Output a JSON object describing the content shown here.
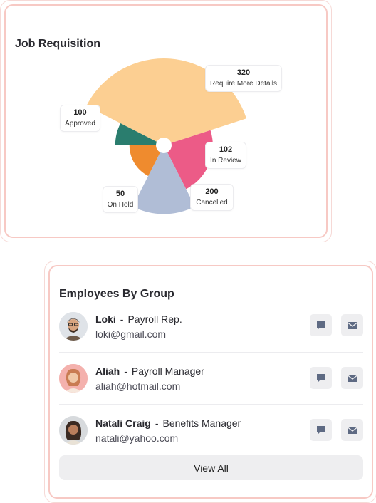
{
  "job_requisition": {
    "title": "Job Requisition"
  },
  "chart_data": {
    "type": "pie",
    "variant": "polar-area",
    "title": "Job Requisition",
    "slices": [
      {
        "label": "Require More Details",
        "value": 320,
        "color": "#fccf92"
      },
      {
        "label": "In Review",
        "value": 102,
        "color": "#ec5b87"
      },
      {
        "label": "Cancelled",
        "value": 200,
        "color": "#b0bdd6"
      },
      {
        "label": "On Hold",
        "value": 50,
        "color": "#ef8b2e"
      },
      {
        "label": "Approved",
        "value": 100,
        "color": "#2a7d6e"
      }
    ],
    "labels": {
      "require": {
        "value": "320",
        "label": "Require More Details"
      },
      "review": {
        "value": "102",
        "label": "In Review"
      },
      "cancelled": {
        "value": "200",
        "label": "Cancelled"
      },
      "onhold": {
        "value": "50",
        "label": "On Hold"
      },
      "approved": {
        "value": "100",
        "label": "Approved"
      }
    }
  },
  "employees": {
    "title": "Employees By Group",
    "items": [
      {
        "name": "Loki",
        "separator": "-",
        "role": "Payroll Rep.",
        "email": "loki@gmail.com",
        "avatar_color": "#d9dde2"
      },
      {
        "name": "Aliah",
        "separator": "-",
        "role": "Payroll Manager",
        "email": "aliah@hotmail.com",
        "avatar_color": "#f4b4b4"
      },
      {
        "name": "Natali Craig",
        "separator": "-",
        "role": "Benefits Manager",
        "email": "natali@yahoo.com",
        "avatar_color": "#d9dde2"
      }
    ],
    "view_all_label": "View All"
  },
  "icons": {
    "message": "message-icon",
    "mail": "mail-icon"
  }
}
